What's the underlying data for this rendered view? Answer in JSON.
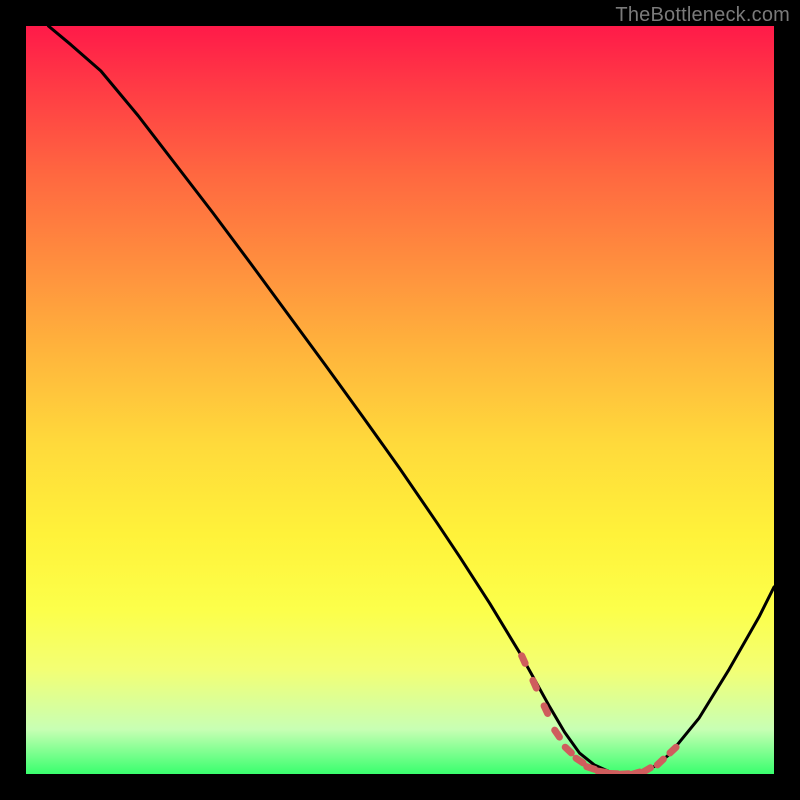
{
  "watermark": "TheBottleneck.com",
  "colors": {
    "background": "#000000",
    "gradient_top": "#ff1a49",
    "gradient_bottom": "#39ff6e",
    "curve_stroke": "#000000",
    "marker_fill": "#cf5d5d",
    "marker_stroke": "#b44a4a"
  },
  "chart_data": {
    "type": "line",
    "title": "",
    "xlabel": "",
    "ylabel": "",
    "xlim": [
      0,
      100
    ],
    "ylim": [
      0,
      100
    ],
    "grid": false,
    "legend": false,
    "series": [
      {
        "name": "bottleneck-curve",
        "x": [
          3,
          6,
          10,
          15,
          20,
          25,
          30,
          35,
          40,
          45,
          50,
          55,
          58,
          62,
          66,
          68,
          70,
          72,
          74,
          76,
          78,
          80,
          82,
          84,
          86,
          90,
          94,
          98,
          100
        ],
        "values": [
          100,
          97.5,
          94,
          88,
          81.5,
          75,
          68.3,
          61.5,
          54.7,
          47.8,
          40.8,
          33.5,
          29,
          22.8,
          16.2,
          12.6,
          9.0,
          5.6,
          2.8,
          1.2,
          0.3,
          0,
          0.2,
          1.0,
          2.6,
          7.5,
          14.0,
          21.0,
          25.0
        ]
      }
    ],
    "annotations": [
      {
        "name": "optimal-range-markers",
        "type": "scatter",
        "x": [
          66.5,
          68.0,
          69.5,
          71.0,
          72.5,
          74.0,
          75.5,
          77.0,
          78.5,
          80.0,
          81.5,
          83.0,
          84.8,
          86.5
        ],
        "values": [
          15.3,
          12.0,
          8.6,
          5.4,
          3.2,
          1.8,
          0.8,
          0.3,
          0.05,
          0.0,
          0.1,
          0.55,
          1.6,
          3.2
        ]
      }
    ]
  }
}
